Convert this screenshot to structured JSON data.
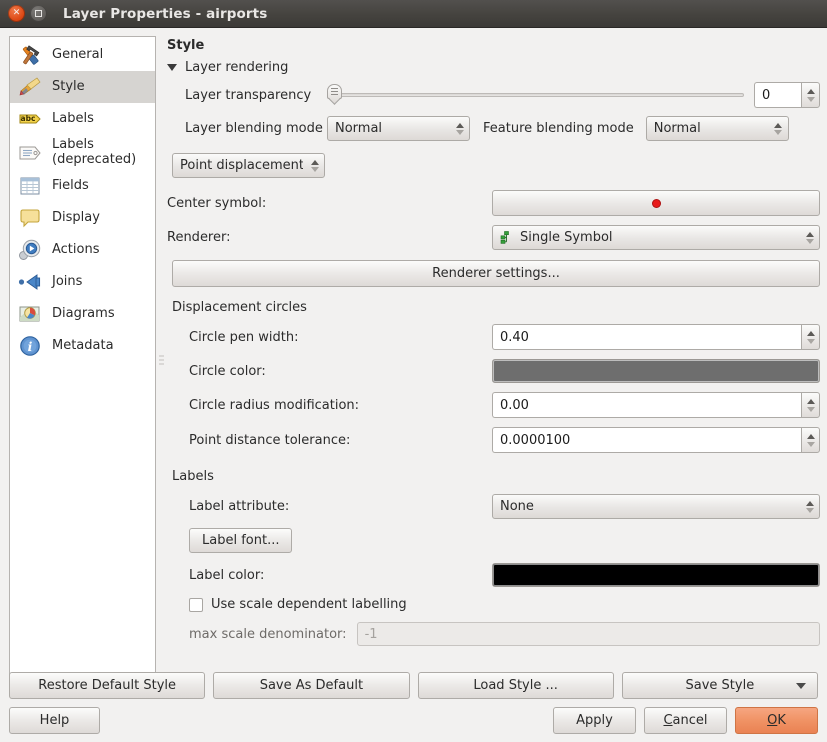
{
  "titlebar": {
    "title": "Layer Properties - airports",
    "close_icon": "close-icon",
    "maximize_icon": "maximize-icon"
  },
  "sidebar": {
    "items": [
      {
        "label": "General",
        "icon": "tools-icon",
        "selected": false
      },
      {
        "label": "Style",
        "icon": "paintbrush-icon",
        "selected": true
      },
      {
        "label": "Labels",
        "icon": "abc-tag-icon",
        "selected": false
      },
      {
        "label": "Labels (deprecated)",
        "icon": "label-tag-icon",
        "selected": false
      },
      {
        "label": "Fields",
        "icon": "table-icon",
        "selected": false
      },
      {
        "label": "Display",
        "icon": "speech-bubble-icon",
        "selected": false
      },
      {
        "label": "Actions",
        "icon": "gear-play-icon",
        "selected": false
      },
      {
        "label": "Joins",
        "icon": "join-arrow-icon",
        "selected": false
      },
      {
        "label": "Diagrams",
        "icon": "pie-chart-map-icon",
        "selected": false
      },
      {
        "label": "Metadata",
        "icon": "info-icon",
        "selected": false
      }
    ]
  },
  "main": {
    "section_title": "Style",
    "layer_rendering": {
      "group_label": "Layer rendering",
      "expanded": true,
      "transparency_label": "Layer transparency",
      "transparency_value": "0",
      "transparency_min": 0,
      "transparency_max": 100,
      "layer_blending_label": "Layer blending mode",
      "layer_blending_value": "Normal",
      "feature_blending_label": "Feature blending mode",
      "feature_blending_value": "Normal"
    },
    "renderer_type": {
      "value": "Point displacement"
    },
    "center_symbol": {
      "label": "Center symbol:",
      "symbol_color": "#e81b1b",
      "symbol_icon": "red-dot-symbol"
    },
    "renderer": {
      "label": "Renderer:",
      "value": "Single Symbol",
      "icon": "single-symbol-icon"
    },
    "renderer_settings_button": "Renderer settings...",
    "displacement_circles": {
      "group_label": "Displacement circles",
      "rows": [
        {
          "label": "Circle pen width:",
          "value": "0.40",
          "type": "spin"
        },
        {
          "label": "Circle color:",
          "value": "#6e6e6e",
          "type": "color"
        },
        {
          "label": "Circle radius modification:",
          "value": "0.00",
          "type": "spin"
        },
        {
          "label": "Point distance tolerance:",
          "value": "0.0000100",
          "type": "spin"
        }
      ]
    },
    "labels": {
      "group_label": "Labels",
      "label_attribute_label": "Label attribute:",
      "label_attribute_value": "None",
      "label_font_button": "Label font...",
      "label_color_label": "Label color:",
      "label_color_value": "#000000",
      "scale_checkbox_label": "Use scale dependent labelling",
      "scale_checkbox_checked": false,
      "max_scale_label": "max scale denominator:",
      "max_scale_placeholder": "-1",
      "max_scale_enabled": false
    }
  },
  "bottom": {
    "restore_default_style": "Restore Default Style",
    "save_as_default": "Save As Default",
    "load_style": "Load Style ...",
    "save_style": "Save Style",
    "save_style_caret": "chevron-down-icon",
    "help": "Help",
    "apply": "Apply",
    "cancel": "Cancel",
    "cancel_mnemonic": "C",
    "ok": "OK",
    "ok_mnemonic": "O",
    "ok_color": "#f09264"
  }
}
